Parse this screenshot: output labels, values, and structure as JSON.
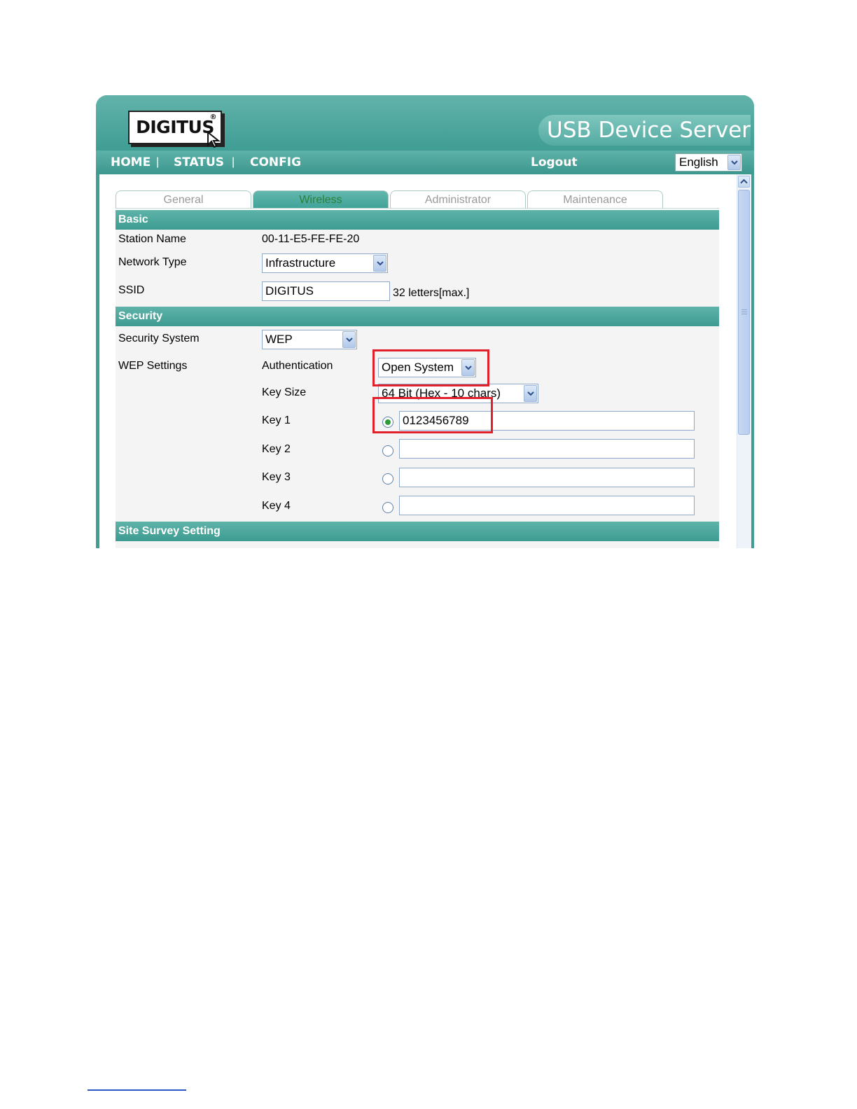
{
  "header": {
    "logo_text": "DIGITUS",
    "logo_mark": "®",
    "product_title": "USB Device Server"
  },
  "nav": {
    "home": "HOME",
    "status": "STATUS",
    "config": "CONFIG",
    "separator": "|",
    "logout": "Logout",
    "language": "English"
  },
  "tabs": [
    {
      "label": "General",
      "active": false
    },
    {
      "label": "Wireless",
      "active": true
    },
    {
      "label": "Administrator",
      "active": false
    },
    {
      "label": "Maintenance",
      "active": false
    }
  ],
  "sections": {
    "basic": "Basic",
    "security": "Security",
    "site_survey": "Site Survey Setting"
  },
  "basic": {
    "station_name_label": "Station Name",
    "station_name_value": "00-11-E5-FE-FE-20",
    "network_type_label": "Network Type",
    "network_type_value": "Infrastructure",
    "ssid_label": "SSID",
    "ssid_value": "DIGITUS",
    "ssid_hint": "32 letters[max.]"
  },
  "security": {
    "system_label": "Security System",
    "system_value": "WEP",
    "wep_settings_label": "WEP Settings",
    "authentication_label": "Authentication",
    "authentication_value": "Open System",
    "key_size_label": "Key Size",
    "key_size_value": "64 Bit (Hex - 10 chars)",
    "keys": [
      {
        "label": "Key 1",
        "value": "0123456789",
        "selected": true
      },
      {
        "label": "Key 2",
        "value": "",
        "selected": false
      },
      {
        "label": "Key 3",
        "value": "",
        "selected": false
      },
      {
        "label": "Key 4",
        "value": "",
        "selected": false
      }
    ]
  },
  "colors": {
    "teal": "#3f9d94",
    "highlight_red": "#e0202a",
    "active_tab_text": "#2c7f3a"
  }
}
